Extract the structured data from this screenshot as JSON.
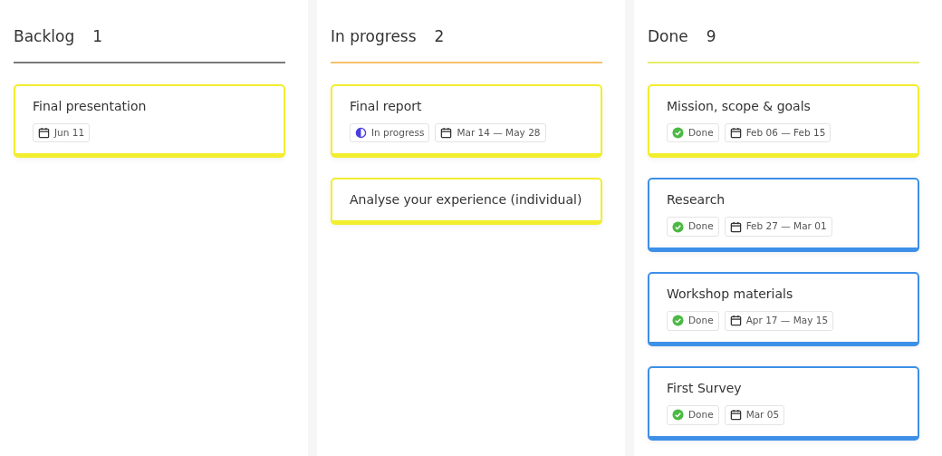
{
  "columns": [
    {
      "title": "Backlog",
      "count": "1",
      "color": "#7a7a7a",
      "cards": [
        {
          "title": "Final presentation",
          "color": "#f2ee2e",
          "date": "Jun 11"
        }
      ]
    },
    {
      "title": "In progress",
      "count": "2",
      "color": "#f7c26b",
      "cards": [
        {
          "title": "Final report",
          "color": "#f2ee2e",
          "status": {
            "kind": "in_progress",
            "label": "In progress"
          },
          "date": "Mar 14 — May 28"
        },
        {
          "title": "Analyse your experience (individual)",
          "color": "#f2ee2e"
        }
      ]
    },
    {
      "title": "Done",
      "count": "9",
      "color": "#e4ee6a",
      "cards": [
        {
          "title": "Mission, scope & goals",
          "color": "#f2ee2e",
          "status": {
            "kind": "done",
            "label": "Done"
          },
          "date": "Feb 06 — Feb 15"
        },
        {
          "title": "Research",
          "color": "#3d8fe8",
          "status": {
            "kind": "done",
            "label": "Done"
          },
          "date": "Feb 27 — Mar 01"
        },
        {
          "title": "Workshop materials",
          "color": "#3d8fe8",
          "status": {
            "kind": "done",
            "label": "Done"
          },
          "date": "Apr 17 — May 15"
        },
        {
          "title": "First Survey",
          "color": "#3d8fe8",
          "status": {
            "kind": "done",
            "label": "Done"
          },
          "date": "Mar 05"
        }
      ]
    }
  ]
}
